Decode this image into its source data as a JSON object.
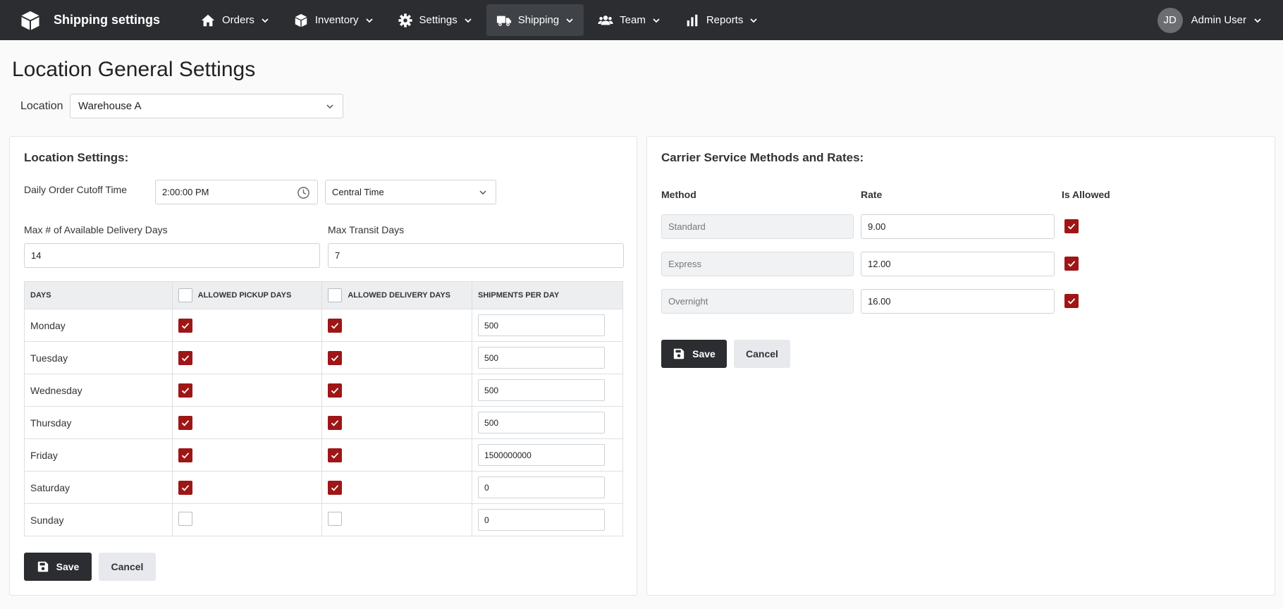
{
  "app": {
    "title": "Shipping settings",
    "logo_icon": "box-icon"
  },
  "nav": {
    "items": [
      {
        "label": "Orders",
        "icon": "home-icon"
      },
      {
        "label": "Inventory",
        "icon": "box-icon"
      },
      {
        "label": "Settings",
        "icon": "gear-icon"
      },
      {
        "label": "Shipping",
        "icon": "truck-icon",
        "active": true
      },
      {
        "label": "Team",
        "icon": "users-icon"
      },
      {
        "label": "Reports",
        "icon": "bar-chart-icon"
      }
    ]
  },
  "user": {
    "initials": "JD",
    "name": "Admin User"
  },
  "page": {
    "title": "Location General Settings",
    "location_label": "Location",
    "location_value": "Warehouse A"
  },
  "location_settings": {
    "title": "Location Settings:",
    "cutoff_label": "Daily Order Cutoff Time",
    "cutoff_value": "2:00:00 PM",
    "timezone_value": "Central Time",
    "max_delivery_label": "Max # of Available Delivery Days",
    "max_delivery_value": "14",
    "max_transit_label": "Max Transit Days",
    "max_transit_value": "7",
    "table": {
      "headers": [
        "DAYS",
        "ALLOWED PICKUP DAYS",
        "ALLOWED DELIVERY DAYS",
        "SHIPMENTS PER DAY"
      ],
      "rows": [
        {
          "day": "Monday",
          "pickup": true,
          "delivery": true,
          "shipments": "500"
        },
        {
          "day": "Tuesday",
          "pickup": true,
          "delivery": true,
          "shipments": "500"
        },
        {
          "day": "Wednesday",
          "pickup": true,
          "delivery": true,
          "shipments": "500"
        },
        {
          "day": "Thursday",
          "pickup": true,
          "delivery": true,
          "shipments": "500"
        },
        {
          "day": "Friday",
          "pickup": true,
          "delivery": true,
          "shipments": "1500000000"
        },
        {
          "day": "Saturday",
          "pickup": true,
          "delivery": true,
          "shipments": "0"
        },
        {
          "day": "Sunday",
          "pickup": false,
          "delivery": false,
          "shipments": "0"
        }
      ]
    },
    "save_label": "Save",
    "cancel_label": "Cancel"
  },
  "carrier": {
    "title": "Carrier Service Methods and Rates:",
    "headers": {
      "method": "Method",
      "rate": "Rate",
      "allowed": "Is Allowed"
    },
    "rows": [
      {
        "method": "Standard",
        "rate": "9.00",
        "allowed": true
      },
      {
        "method": "Express",
        "rate": "12.00",
        "allowed": true
      },
      {
        "method": "Overnight",
        "rate": "16.00",
        "allowed": true
      }
    ],
    "save_label": "Save",
    "cancel_label": "Cancel"
  },
  "colors": {
    "topbar": "#2b2d30",
    "accent_check": "#9e1616"
  }
}
